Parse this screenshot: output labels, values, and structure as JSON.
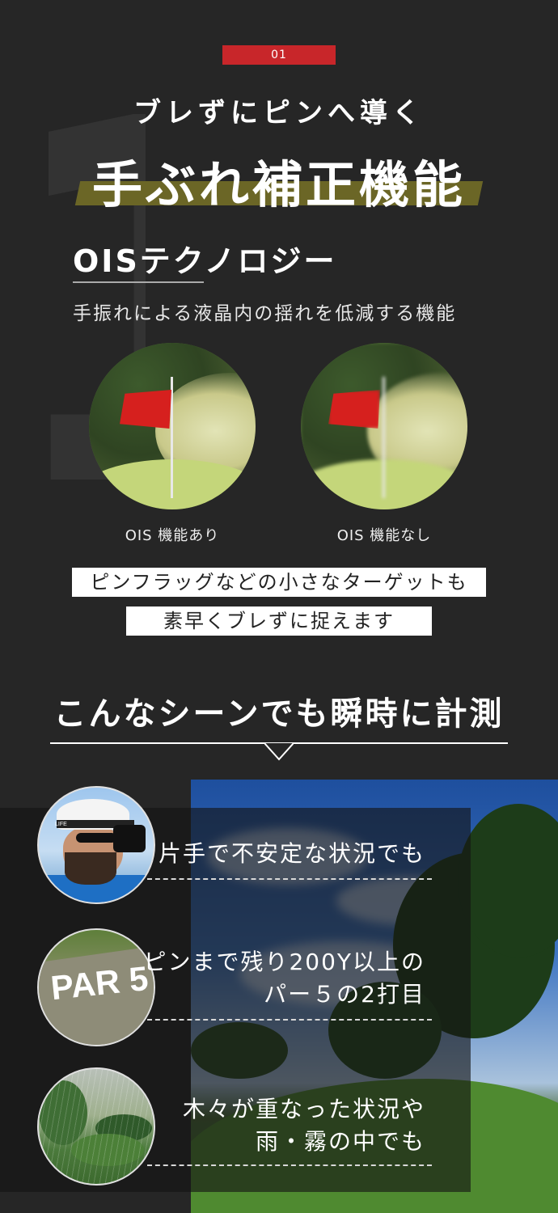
{
  "section": {
    "number_badge": "01",
    "big_number": "1",
    "subtitle": "ブレずにピンへ導く",
    "title": "手ぶれ補正機能",
    "tech_name": "OISテクノロジー",
    "description": "手振れによる液晶内の揺れを低減する機能"
  },
  "comparison": {
    "with_label": "OIS 機能あり",
    "without_label": "OIS 機能なし"
  },
  "callout": {
    "line1": "ピンフラッグなどの小さなターゲットも",
    "line2": "素早くブレずに捉えます"
  },
  "scenes": {
    "heading": "こんなシーンでも瞬時に計測",
    "items": [
      {
        "line1": "片手で不安定な状況でも",
        "line2": ""
      },
      {
        "line1": "ピンまで残り200Y以上の",
        "line2": "パー５の2打目"
      },
      {
        "line1": "木々が重なった状況や",
        "line2": "雨・霧の中でも"
      }
    ],
    "par_sign": "PAR 5",
    "cap_text": "LIFE"
  },
  "colors": {
    "background": "#262626",
    "badge_red": "#c8262a",
    "title_band_olive": "#6b6626",
    "text_white": "#ffffff"
  }
}
